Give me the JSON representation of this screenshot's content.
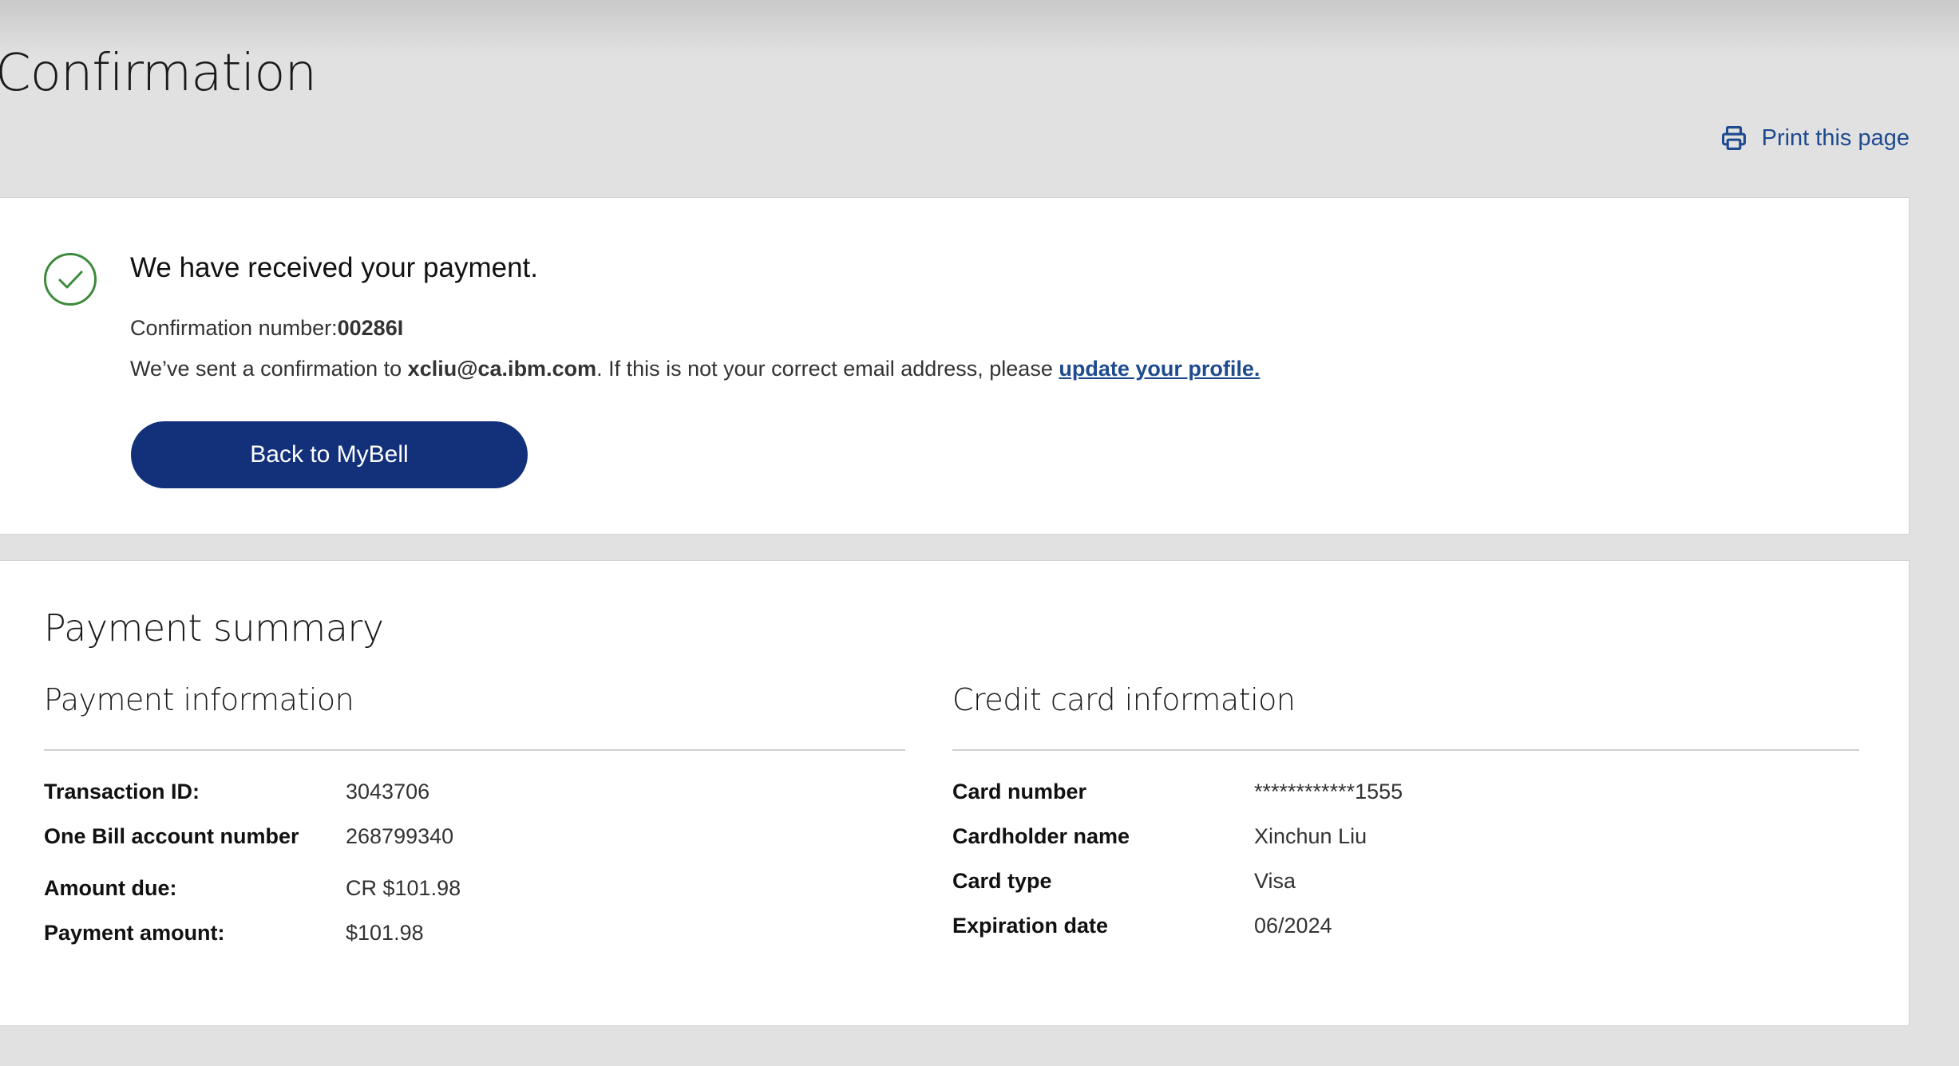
{
  "page": {
    "title": "Confirmation",
    "print_label": "Print this page"
  },
  "confirmation": {
    "heading": "We have received your payment.",
    "number_label": "Confirmation number:",
    "number_value": "00286I",
    "email_prefix": "We’ve sent a confirmation to ",
    "email": "xcliu@ca.ibm.com",
    "email_suffix": ". If this is not your correct email address, please ",
    "update_link": "update your profile.",
    "back_button": "Back to MyBell"
  },
  "summary": {
    "title": "Payment summary",
    "payment_info": {
      "heading": "Payment information",
      "rows": [
        {
          "label": "Transaction ID:",
          "value": "3043706"
        },
        {
          "label": "One Bill account number",
          "value": "268799340"
        },
        {
          "label": "Amount due:",
          "value": "CR $101.98"
        },
        {
          "label": "Payment amount:",
          "value": "$101.98"
        }
      ]
    },
    "card_info": {
      "heading": "Credit card information",
      "rows": [
        {
          "label": "Card number",
          "value": "************1555"
        },
        {
          "label": "Cardholder name",
          "value": "Xinchun Liu"
        },
        {
          "label": "Card type",
          "value": "Visa"
        },
        {
          "label": "Expiration date",
          "value": "06/2024"
        }
      ]
    }
  },
  "colors": {
    "background": "#e1e1e1",
    "card": "#ffffff",
    "link": "#1e4b8f",
    "button": "#13317a",
    "success": "#3d8a3d"
  },
  "icons": {
    "print": "printer-icon",
    "success": "check-circle-icon"
  }
}
